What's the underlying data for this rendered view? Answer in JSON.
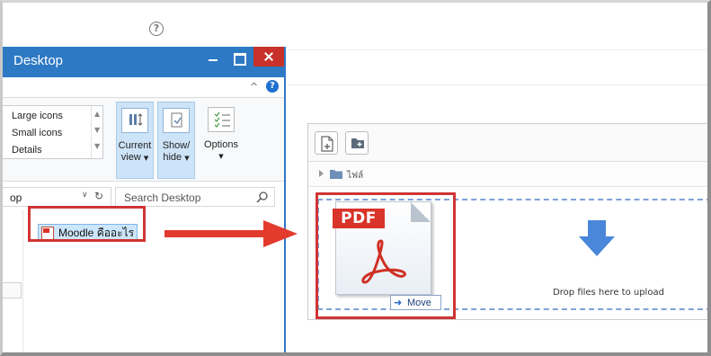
{
  "explorer": {
    "title": "Desktop",
    "layout_options": [
      "Large icons",
      "Small icons",
      "Details"
    ],
    "current_view": {
      "line1": "Current",
      "line2": "view"
    },
    "show_hide": {
      "line1": "Show/",
      "line2": "hide"
    },
    "options": "Options",
    "address": "op",
    "search_placeholder": "Search Desktop",
    "file_name": "Moodle คืออะไร"
  },
  "moodle": {
    "filemanager": {
      "path_label": "ไฟล์",
      "drop_text": "Drop files here to upload"
    },
    "drag": {
      "icon_label": "PDF",
      "tooltip": "Move"
    }
  },
  "colors": {
    "explorer_titlebar": "#2d79c4",
    "close_button": "#c7312a",
    "highlight": "#d13434",
    "drop_border": "#7fa2d8",
    "drop_arrow": "#4a86d9"
  }
}
